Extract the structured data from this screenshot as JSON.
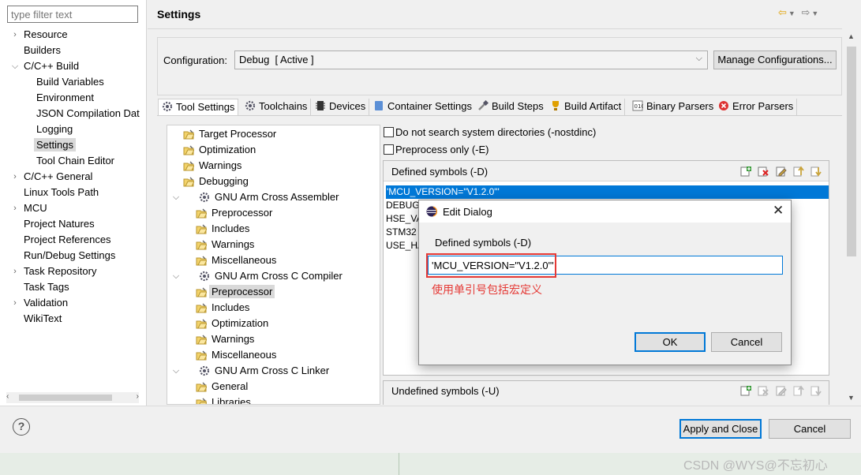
{
  "filter": {
    "placeholder": "type filter text"
  },
  "tree": [
    {
      "label": "Resource",
      "indent": 0,
      "twisty": "closed"
    },
    {
      "label": "Builders",
      "indent": 0,
      "twisty": "none"
    },
    {
      "label": "C/C++ Build",
      "indent": 0,
      "twisty": "open"
    },
    {
      "label": "Build Variables",
      "indent": 1,
      "twisty": "none"
    },
    {
      "label": "Environment",
      "indent": 1,
      "twisty": "none"
    },
    {
      "label": "JSON Compilation Dat",
      "indent": 1,
      "twisty": "none"
    },
    {
      "label": "Logging",
      "indent": 1,
      "twisty": "none"
    },
    {
      "label": "Settings",
      "indent": 1,
      "twisty": "none",
      "selected": true
    },
    {
      "label": "Tool Chain Editor",
      "indent": 1,
      "twisty": "none"
    },
    {
      "label": "C/C++ General",
      "indent": 0,
      "twisty": "closed"
    },
    {
      "label": "Linux Tools Path",
      "indent": 0,
      "twisty": "none"
    },
    {
      "label": "MCU",
      "indent": 0,
      "twisty": "closed"
    },
    {
      "label": "Project Natures",
      "indent": 0,
      "twisty": "none"
    },
    {
      "label": "Project References",
      "indent": 0,
      "twisty": "none"
    },
    {
      "label": "Run/Debug Settings",
      "indent": 0,
      "twisty": "none"
    },
    {
      "label": "Task Repository",
      "indent": 0,
      "twisty": "closed"
    },
    {
      "label": "Task Tags",
      "indent": 0,
      "twisty": "none"
    },
    {
      "label": "Validation",
      "indent": 0,
      "twisty": "closed"
    },
    {
      "label": "WikiText",
      "indent": 0,
      "twisty": "none"
    }
  ],
  "header": {
    "title": "Settings"
  },
  "configuration": {
    "label": "Configuration:",
    "value": "Debug  [ Active ]",
    "manage_label": "Manage Configurations..."
  },
  "tabs": [
    {
      "label": "Tool Settings",
      "icon": "tool-settings-icon",
      "active": true
    },
    {
      "label": "Toolchains",
      "icon": "toolchains-icon"
    },
    {
      "label": "Devices",
      "icon": "devices-icon"
    },
    {
      "label": "Container Settings",
      "icon": "container-settings-icon"
    },
    {
      "label": "Build Steps",
      "icon": "build-steps-icon"
    },
    {
      "label": "Build Artifact",
      "icon": "build-artifact-icon"
    },
    {
      "label": "Binary Parsers",
      "icon": "binary-parsers-icon"
    },
    {
      "label": "Error Parsers",
      "icon": "error-parsers-icon"
    }
  ],
  "tool_tree": [
    {
      "label": "Target Processor",
      "level": 1
    },
    {
      "label": "Optimization",
      "level": 1
    },
    {
      "label": "Warnings",
      "level": 1
    },
    {
      "label": "Debugging",
      "level": 1
    },
    {
      "label": "GNU Arm Cross Assembler",
      "level": 0,
      "tool": true
    },
    {
      "label": "Preprocessor",
      "level": 2
    },
    {
      "label": "Includes",
      "level": 2
    },
    {
      "label": "Warnings",
      "level": 2
    },
    {
      "label": "Miscellaneous",
      "level": 2
    },
    {
      "label": "GNU Arm Cross C Compiler",
      "level": 0,
      "tool": true
    },
    {
      "label": "Preprocessor",
      "level": 2,
      "selected": true
    },
    {
      "label": "Includes",
      "level": 2
    },
    {
      "label": "Optimization",
      "level": 2
    },
    {
      "label": "Warnings",
      "level": 2
    },
    {
      "label": "Miscellaneous",
      "level": 2
    },
    {
      "label": "GNU Arm Cross C Linker",
      "level": 0,
      "tool": true
    },
    {
      "label": "General",
      "level": 2
    },
    {
      "label": "Libraries",
      "level": 2
    }
  ],
  "options": {
    "nostdinc_label": "Do not search system directories (-nostdinc)",
    "nostdinc_checked": false,
    "preprocess_label": "Preprocess only (-E)",
    "preprocess_checked": false
  },
  "defined_symbols": {
    "title": "Defined symbols (-D)",
    "items": [
      "'MCU_VERSION=\"V1.2.0\"'",
      "DEBUG",
      "HSE_VA",
      "STM32",
      "USE_HA"
    ],
    "selected_index": 0
  },
  "undefined_symbols": {
    "title": "Undefined symbols (-U)"
  },
  "footer": {
    "help": "?",
    "apply_close_label": "Apply and Close",
    "cancel_label": "Cancel"
  },
  "dialog": {
    "title": "Edit Dialog",
    "close": "✕",
    "field_label": "Defined symbols (-D)",
    "value": "'MCU_VERSION=\"V1.2.0\"'",
    "annotation": "使用单引号包括宏定义",
    "ok_label": "OK",
    "cancel_label": "Cancel"
  },
  "watermark": "CSDN @WYS@不忘初心",
  "colors": {
    "selection": "#0078d7",
    "annotation": "#e53935",
    "accent": "#0078d7"
  }
}
